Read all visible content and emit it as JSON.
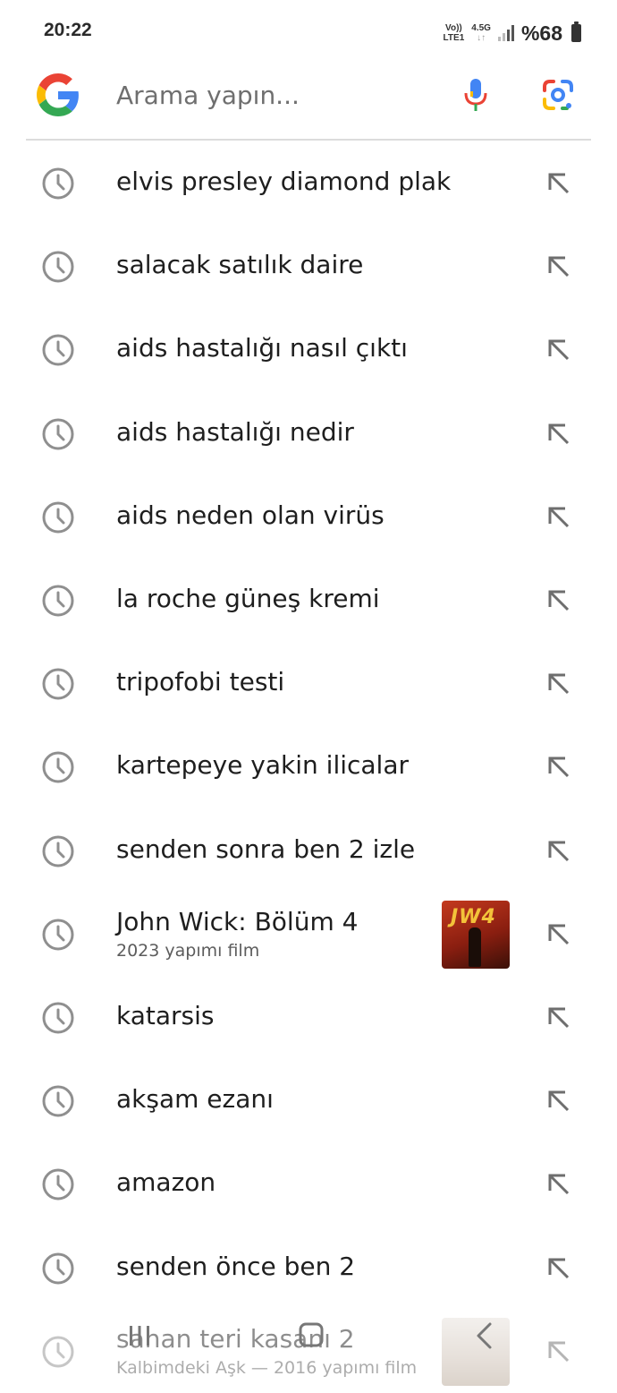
{
  "status_bar": {
    "time": "20:22",
    "network_top": "Vo))",
    "network_bottom": "LTE1",
    "network_type": "4.5G",
    "battery": "%68"
  },
  "search": {
    "placeholder": "Arama yapın...",
    "value": ""
  },
  "colors": {
    "google_blue": "#4285F4",
    "google_red": "#EA4335",
    "google_yellow": "#FBBC05",
    "google_green": "#34A853",
    "icon_gray": "#8a8a8a"
  },
  "suggestions": [
    {
      "text": "elvis presley diamond plak"
    },
    {
      "text": "salacak satılık daire"
    },
    {
      "text": "aids hastalığı nasıl çıktı"
    },
    {
      "text": "aids hastalığı nedir"
    },
    {
      "text": "aids neden olan virüs"
    },
    {
      "text": "la roche güneş kremi"
    },
    {
      "text": "tripofobi testi"
    },
    {
      "text": "kartepeye yakin ilicalar"
    },
    {
      "text": "senden sonra ben 2 izle"
    },
    {
      "text": "John Wick: Bölüm 4",
      "subtitle": "2023 yapımı film",
      "thumbnail_text": "JW4"
    },
    {
      "text": "katarsis"
    },
    {
      "text": "akşam ezanı"
    },
    {
      "text": "amazon"
    },
    {
      "text": "senden önce ben 2"
    },
    {
      "text": "sahan teri kasanı 2",
      "subtitle": "Kalbimdeki Aşk — 2016 yapımı film"
    }
  ],
  "icons": {
    "history": "clock-icon",
    "fill_query": "arrow-up-left-icon",
    "voice": "mic-icon",
    "camera_search": "google-lens-icon"
  }
}
